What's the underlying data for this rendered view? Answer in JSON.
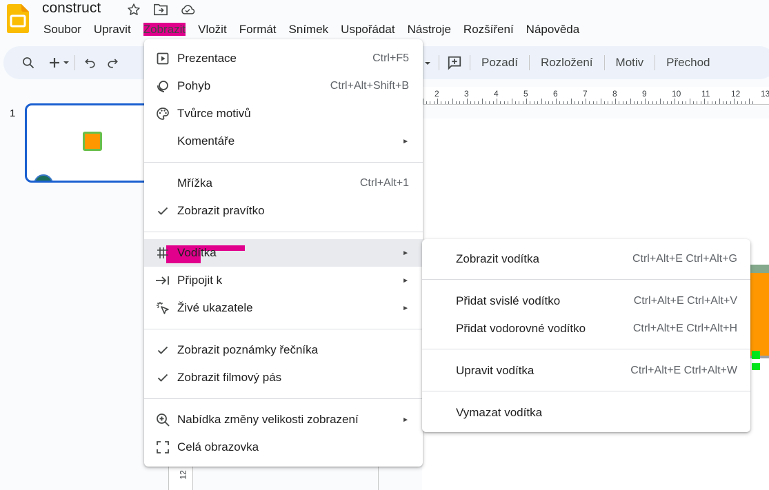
{
  "app": {
    "title": "construct",
    "icons": [
      "slides-logo-icon",
      "star-icon",
      "move-to-folder-icon",
      "cloud-saved-icon"
    ]
  },
  "menubar": {
    "items": [
      {
        "label": "Soubor"
      },
      {
        "label": "Upravit"
      },
      {
        "label": "Zobrazit"
      },
      {
        "label": "Vložit"
      },
      {
        "label": "Formát"
      },
      {
        "label": "Snímek"
      },
      {
        "label": "Uspořádat"
      },
      {
        "label": "Nástroje"
      },
      {
        "label": "Rozšíření"
      },
      {
        "label": "Nápověda"
      }
    ]
  },
  "toolbar": {
    "right": {
      "background": "Pozadí",
      "layout": "Rozložení",
      "theme": "Motiv",
      "transition": "Přechod"
    }
  },
  "filmstrip": {
    "slide_number": "1"
  },
  "ruler": {
    "labels": [
      "2",
      "3",
      "4",
      "5",
      "6",
      "7",
      "8",
      "9",
      "10",
      "11",
      "12",
      "13"
    ],
    "vertical_label": "12"
  },
  "view_menu": {
    "items": [
      {
        "label": "Prezentace",
        "shortcut": "Ctrl+F5",
        "icon": "present-icon"
      },
      {
        "label": "Pohyb",
        "shortcut": "Ctrl+Alt+Shift+B",
        "icon": "motion-icon"
      },
      {
        "label": "Tvůrce motivů",
        "shortcut": "",
        "icon": "palette-icon"
      },
      {
        "label": "Komentáře",
        "shortcut": "",
        "icon": ""
      },
      {
        "label": "Mřížka",
        "shortcut": "Ctrl+Alt+1",
        "icon": ""
      },
      {
        "label": "Zobrazit pravítko",
        "shortcut": "",
        "icon": "check-icon"
      },
      {
        "label": "Vodítka",
        "shortcut": "",
        "icon": "guides-icon"
      },
      {
        "label": "Připojit k",
        "shortcut": "",
        "icon": "snap-to-icon"
      },
      {
        "label": "Živé ukazatele",
        "shortcut": "",
        "icon": "live-pointers-icon"
      },
      {
        "label": "Zobrazit poznámky řečníka",
        "shortcut": "",
        "icon": "check-icon"
      },
      {
        "label": "Zobrazit filmový pás",
        "shortcut": "",
        "icon": "check-icon"
      },
      {
        "label": "Nabídka změny velikosti zobrazení",
        "shortcut": "",
        "icon": "zoom-icon"
      },
      {
        "label": "Celá obrazovka",
        "shortcut": "",
        "icon": "fullscreen-icon"
      }
    ]
  },
  "guides_submenu": {
    "items": [
      {
        "label": "Zobrazit vodítka",
        "shortcut": "Ctrl+Alt+E Ctrl+Alt+G"
      },
      {
        "label": "Přidat svislé vodítko",
        "shortcut": "Ctrl+Alt+E Ctrl+Alt+V"
      },
      {
        "label": "Přidat vodorovné vodítko",
        "shortcut": "Ctrl+Alt+E Ctrl+Alt+H"
      },
      {
        "label": "Upravit vodítka",
        "shortcut": "Ctrl+Alt+E Ctrl+Alt+W"
      },
      {
        "label": "Vymazat vodítka",
        "shortcut": ""
      }
    ]
  },
  "colors": {
    "highlight_pink": "#e0008c",
    "selection_blue": "#1a5fd0",
    "shape_orange": "#ff9800",
    "shape_green": "#6abf4b"
  }
}
